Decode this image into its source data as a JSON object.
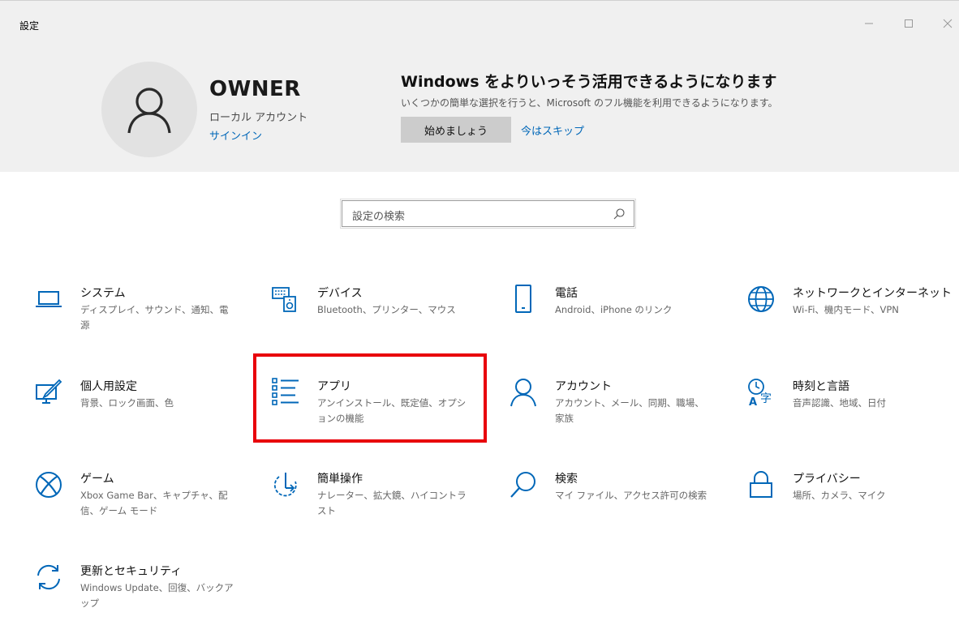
{
  "window": {
    "title": "設定",
    "controls": {
      "minimize": "—",
      "maximize": "☐",
      "close": "✕"
    }
  },
  "account": {
    "name": "OWNER",
    "type": "ローカル アカウント",
    "signin": "サインイン"
  },
  "promo": {
    "title": "Windows をよりいっそう活用できるようになります",
    "description": "いくつかの簡単な選択を行うと、Microsoft のフル機能を利用できるようになります。",
    "start_button": "始めましょう",
    "skip_link": "今はスキップ"
  },
  "search": {
    "placeholder": "設定の検索"
  },
  "accent_color": "#0067b8",
  "highlight_color": "#e8000b",
  "tiles": [
    {
      "title": "システム",
      "description": "ディスプレイ、サウンド、通知、電源",
      "icon": "laptop-icon"
    },
    {
      "title": "デバイス",
      "description": "Bluetooth、プリンター、マウス",
      "icon": "keyboard-speaker-icon"
    },
    {
      "title": "電話",
      "description": "Android、iPhone のリンク",
      "icon": "phone-icon"
    },
    {
      "title": "ネットワークとインターネット",
      "description": "Wi-Fi、機内モード、VPN",
      "icon": "globe-icon"
    },
    {
      "title": "個人用設定",
      "description": "背景、ロック画面、色",
      "icon": "paintbrush-icon"
    },
    {
      "title": "アプリ",
      "description": "アンインストール、既定値、オプションの機能",
      "icon": "app-list-icon",
      "highlighted": true
    },
    {
      "title": "アカウント",
      "description": "アカウント、メール、同期、職場、家族",
      "icon": "person-icon"
    },
    {
      "title": "時刻と言語",
      "description": "音声認識、地域、日付",
      "icon": "time-language-icon"
    },
    {
      "title": "ゲーム",
      "description": "Xbox Game Bar、キャプチャ、配信、ゲーム モード",
      "icon": "xbox-icon"
    },
    {
      "title": "簡単操作",
      "description": "ナレーター、拡大鏡、ハイコントラスト",
      "icon": "ease-of-access-icon"
    },
    {
      "title": "検索",
      "description": "マイ ファイル、アクセス許可の検索",
      "icon": "search-icon"
    },
    {
      "title": "プライバシー",
      "description": "場所、カメラ、マイク",
      "icon": "lock-icon"
    },
    {
      "title": "更新とセキュリティ",
      "description": "Windows Update、回復、バックアップ",
      "icon": "sync-icon"
    }
  ]
}
